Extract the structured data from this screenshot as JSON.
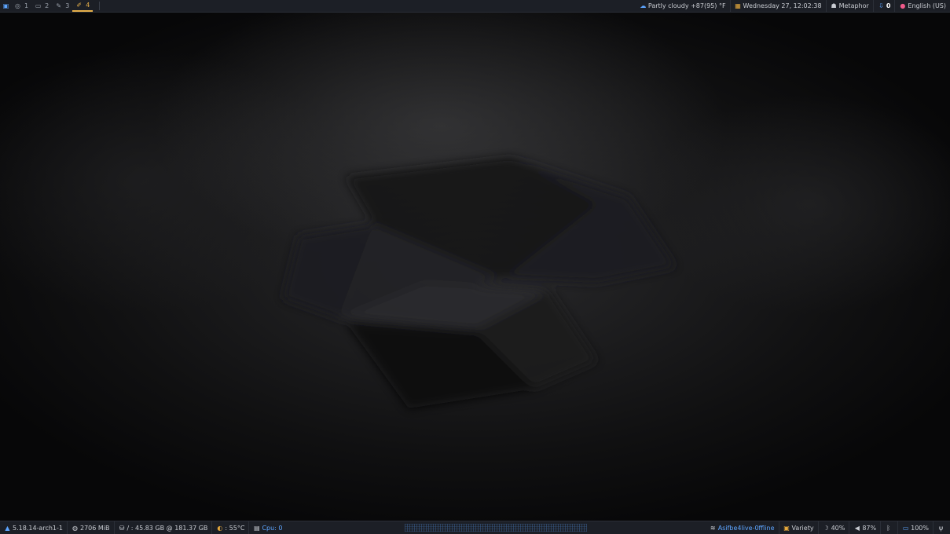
{
  "top_bar": {
    "workspaces": [
      {
        "label": "1",
        "icon": "browser-icon"
      },
      {
        "label": "2",
        "icon": "folder-icon"
      },
      {
        "label": "3",
        "icon": "pen-icon"
      },
      {
        "label": "4",
        "icon": "brush-icon",
        "active": true
      }
    ],
    "weather": "Partly cloudy +87(95) °F",
    "datetime": "Wednesday 27, 12:02:38",
    "user": "Metaphor",
    "updates": "0",
    "keyboard": "English (US)"
  },
  "bottom_bar": {
    "kernel": "5.18.14-arch1-1",
    "memory": "2706 MiB",
    "disk": "/ : 45.83 GB @ 181.37 GB",
    "temperature": ": 55°C",
    "cpu": "Cpu: 0",
    "network": "Asifbe4live-0ffline",
    "wallpaper": "Variety",
    "brightness": "40%",
    "volume": "87%",
    "battery": "100%"
  },
  "colors": {
    "bar_bg": "#1c1f26",
    "accent_blue": "#5da5ff",
    "accent_orange": "#e6a93c"
  }
}
